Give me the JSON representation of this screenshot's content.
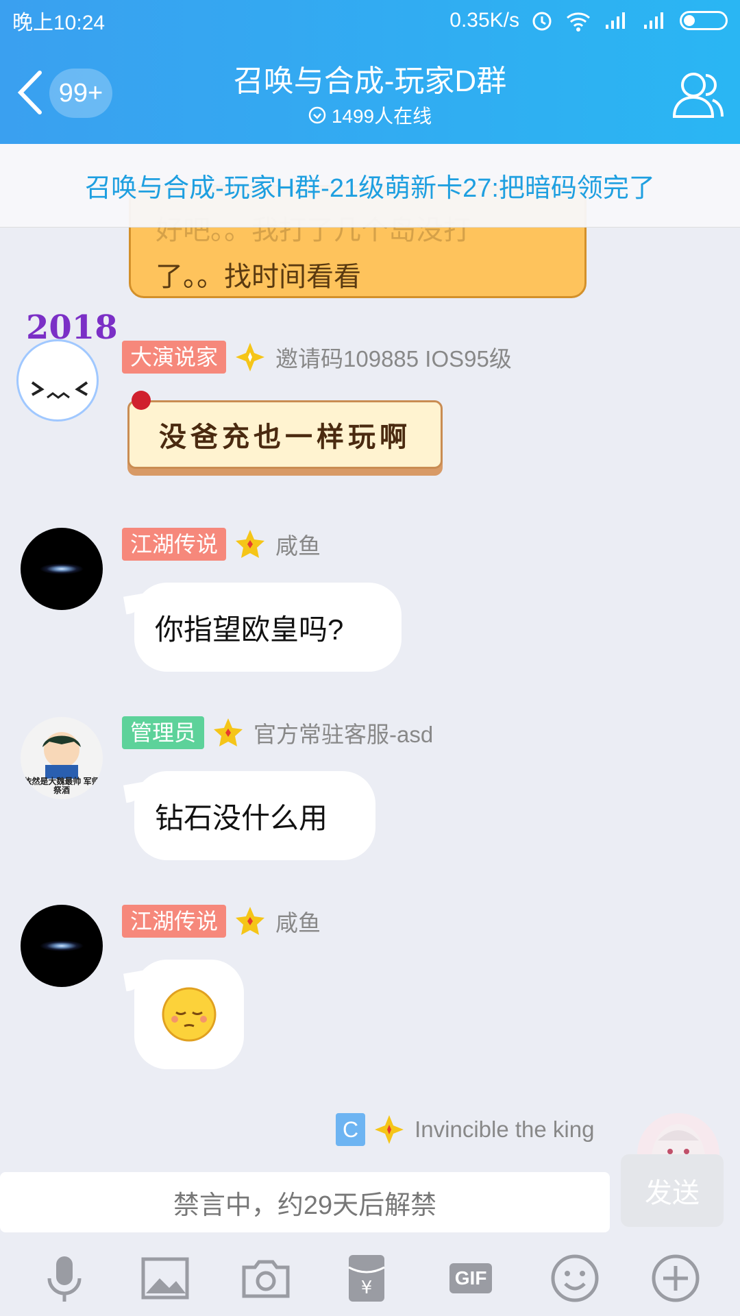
{
  "status_bar": {
    "time": "晚上10:24",
    "net_speed": "0.35K/s"
  },
  "header": {
    "back_badge": "99+",
    "title": "召唤与合成-玩家D群",
    "online": "1499人在线"
  },
  "banner": {
    "text": "召唤与合成-玩家H群-21级萌新卡27:把暗码领完了"
  },
  "messages": [
    {
      "text_line1": "好吧。。我打了几个岛没打",
      "text_line2": "了。。找时间看看"
    },
    {
      "tag": "大演说家",
      "nick": "邀请码109885 IOS95级",
      "text": "没爸充也一样玩啊",
      "avatar_label": "2018"
    },
    {
      "tag": "江湖传说",
      "nick": "咸鱼",
      "text": "你指望欧皇吗?"
    },
    {
      "tag": "管理员",
      "nick": "官方常驻客服-asd",
      "text": "钻石没什么用",
      "avatar_label": "依然是大魏最帅 军师祭酒"
    },
    {
      "tag": "江湖传说",
      "nick": "咸鱼",
      "text": ""
    },
    {
      "tag": "C",
      "nick": "Invincible the king"
    }
  ],
  "input": {
    "muted_text": "禁言中，约29天后解禁",
    "send_label": "发送"
  },
  "toolbar": {
    "gif_label": "GIF"
  },
  "colors": {
    "header": "#2ab6f3",
    "banner_text": "#1e9fe0",
    "tag_red": "#f6887b",
    "tag_green": "#5dd29a",
    "tag_blue": "#6db4f2"
  }
}
